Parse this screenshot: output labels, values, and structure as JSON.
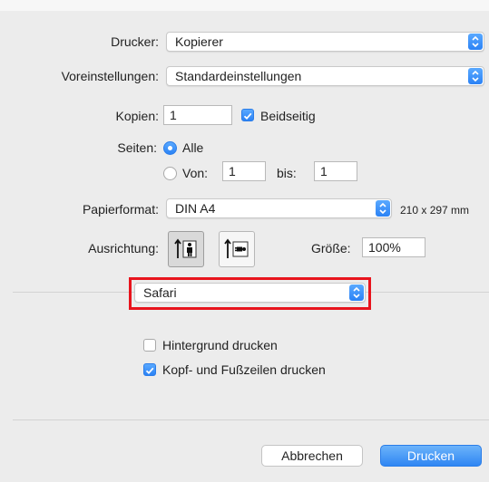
{
  "printer": {
    "label": "Drucker:",
    "value": "Kopierer"
  },
  "presets": {
    "label": "Voreinstellungen:",
    "value": "Standardeinstellungen"
  },
  "copies": {
    "label": "Kopien:",
    "value": "1",
    "duplex_label": "Beidseitig",
    "duplex_checked": true
  },
  "pages": {
    "label": "Seiten:",
    "all_label": "Alle",
    "range_label": "Von:",
    "from_value": "1",
    "to_label": "bis:",
    "to_value": "1",
    "selected": "all"
  },
  "paper": {
    "label": "Papierformat:",
    "value": "DIN A4",
    "size_text": "210 x 297 mm"
  },
  "orientation": {
    "label": "Ausrichtung:",
    "selected": "portrait",
    "options": [
      "portrait-icon",
      "landscape-icon"
    ]
  },
  "scale": {
    "label": "Größe:",
    "value": "100%"
  },
  "app_options": {
    "value": "Safari",
    "highlight_color": "#e8141d"
  },
  "safari": {
    "bg_label": "Hintergrund drucken",
    "bg_checked": false,
    "hf_label": "Kopf- und Fußzeilen drucken",
    "hf_checked": true
  },
  "buttons": {
    "cancel": "Abbrechen",
    "print": "Drucken"
  },
  "colors": {
    "accent": "#2f86f3",
    "dialog_bg": "#ececec"
  }
}
